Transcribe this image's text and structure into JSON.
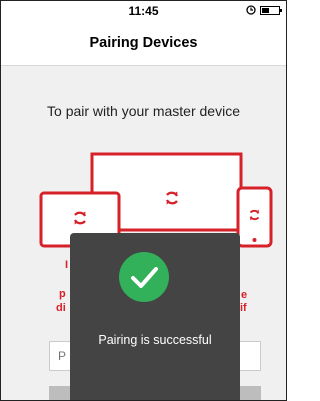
{
  "status_bar": {
    "time": "11:45",
    "battery_level": 0.45
  },
  "header": {
    "title": "Pairing Devices"
  },
  "main": {
    "instruction": "To pair with your master device",
    "obscured_text_fragments": [
      "I",
      "p",
      "di",
      "e",
      "if"
    ],
    "input_placeholder": "P"
  },
  "toast": {
    "message": "Pairing is successful"
  },
  "colors": {
    "accent_red": "#d62128",
    "success_green": "#32b05a",
    "toast_bg": "#444444"
  },
  "icons": [
    "sync-icon",
    "checkmark-icon",
    "alarm-icon",
    "battery-icon"
  ]
}
